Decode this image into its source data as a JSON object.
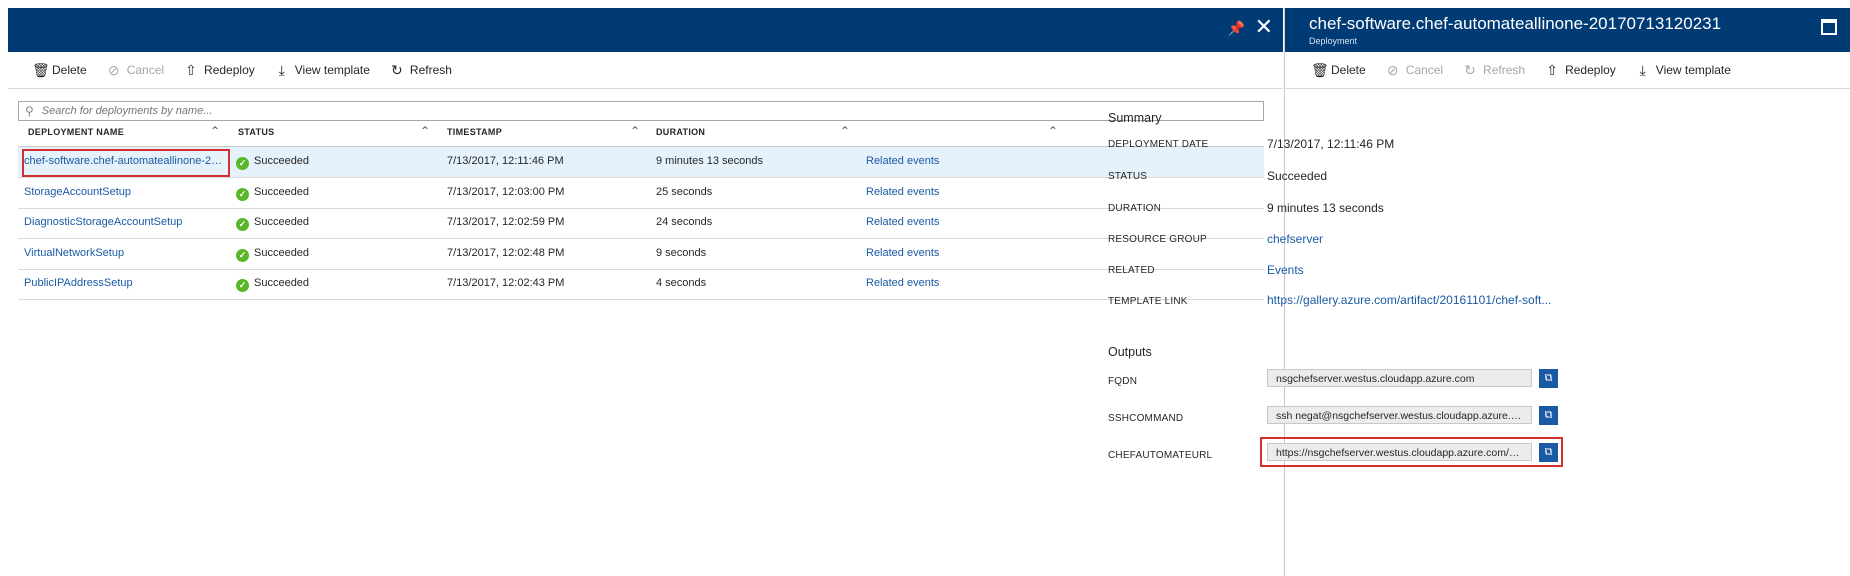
{
  "left": {
    "toolbar": [
      {
        "label": "Delete",
        "icon": "trash-icon",
        "glyph": "🗑",
        "disabled": false
      },
      {
        "label": "Cancel",
        "icon": "cancel-icon",
        "glyph": "⊘",
        "disabled": true
      },
      {
        "label": "Redeploy",
        "icon": "redeploy-icon",
        "glyph": "⇧",
        "disabled": false
      },
      {
        "label": "View template",
        "icon": "download-icon",
        "glyph": "⤓",
        "disabled": false
      },
      {
        "label": "Refresh",
        "icon": "refresh-icon",
        "glyph": "↻",
        "disabled": false
      }
    ],
    "search_placeholder": "Search for deployments by name...",
    "columns": [
      "DEPLOYMENT NAME",
      "STATUS",
      "TIMESTAMP",
      "DURATION"
    ],
    "rows": [
      {
        "name": "chef-software.chef-automateallinone-2017...",
        "status": "Succeeded",
        "timestamp": "7/13/2017, 12:11:46 PM",
        "duration": "9 minutes 13 seconds",
        "events": "Related events"
      },
      {
        "name": "StorageAccountSetup",
        "status": "Succeeded",
        "timestamp": "7/13/2017, 12:03:00 PM",
        "duration": "25 seconds",
        "events": "Related events"
      },
      {
        "name": "DiagnosticStorageAccountSetup",
        "status": "Succeeded",
        "timestamp": "7/13/2017, 12:02:59 PM",
        "duration": "24 seconds",
        "events": "Related events"
      },
      {
        "name": "VirtualNetworkSetup",
        "status": "Succeeded",
        "timestamp": "7/13/2017, 12:02:48 PM",
        "duration": "9 seconds",
        "events": "Related events"
      },
      {
        "name": "PublicIPAddressSetup",
        "status": "Succeeded",
        "timestamp": "7/13/2017, 12:02:43 PM",
        "duration": "4 seconds",
        "events": "Related events"
      }
    ]
  },
  "right": {
    "title": "chef-software.chef-automateallinone-20170713120231",
    "subtitle": "Deployment",
    "toolbar": [
      {
        "label": "Delete",
        "icon": "trash-icon",
        "glyph": "🗑",
        "disabled": false
      },
      {
        "label": "Cancel",
        "icon": "cancel-icon",
        "glyph": "⊘",
        "disabled": true
      },
      {
        "label": "Refresh",
        "icon": "refresh-icon",
        "glyph": "↻",
        "disabled": true
      },
      {
        "label": "Redeploy",
        "icon": "redeploy-icon",
        "glyph": "⇧",
        "disabled": false
      },
      {
        "label": "View template",
        "icon": "download-icon",
        "glyph": "⤓",
        "disabled": false
      }
    ],
    "summary_heading": "Summary",
    "summary": {
      "deployment_date_label": "DEPLOYMENT DATE",
      "deployment_date": "7/13/2017, 12:11:46 PM",
      "status_label": "STATUS",
      "status": "Succeeded",
      "duration_label": "DURATION",
      "duration": "9 minutes 13 seconds",
      "resource_group_label": "RESOURCE GROUP",
      "resource_group": "chefserver",
      "related_label": "RELATED",
      "related": "Events",
      "template_link_label": "TEMPLATE LINK",
      "template_link": "https://gallery.azure.com/artifact/20161101/chef-soft..."
    },
    "outputs_heading": "Outputs",
    "outputs": [
      {
        "label": "FQDN",
        "value": "nsgchefserver.westus.cloudapp.azure.com"
      },
      {
        "label": "SSHCOMMAND",
        "value": "ssh negat@nsgchefserver.westus.cloudapp.azure.com"
      },
      {
        "label": "CHEFAUTOMATEURL",
        "value": "https://nsgchefserver.westus.cloudapp.azure.com/bisc..."
      }
    ]
  },
  "colors": {
    "titlebar": "#003b75",
    "link": "#1a5aa4",
    "success": "#5ab72a",
    "highlight": "#d32f2f"
  }
}
